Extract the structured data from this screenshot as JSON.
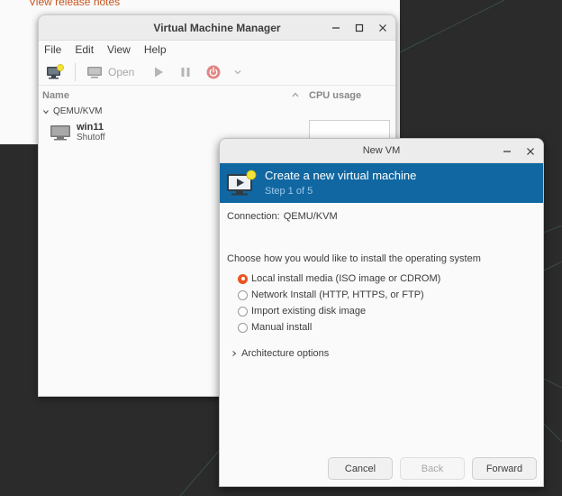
{
  "background": {
    "release_link": "View release notes"
  },
  "vmm": {
    "title": "Virtual Machine Manager",
    "menu": [
      "File",
      "Edit",
      "View",
      "Help"
    ],
    "toolbar": {
      "open_label": "Open"
    },
    "columns": {
      "name": "Name",
      "cpu": "CPU usage"
    },
    "group": "QEMU/KVM",
    "vm": {
      "name": "win11",
      "status": "Shutoff"
    }
  },
  "newvm": {
    "title": "New VM",
    "banner": {
      "title": "Create a new virtual machine",
      "step": "Step 1 of 5"
    },
    "connection": {
      "label": "Connection:",
      "value": "QEMU/KVM"
    },
    "choose_label": "Choose how you would like to install the operating system",
    "options": [
      {
        "label": "Local install media (ISO image or CDROM)",
        "selected": true
      },
      {
        "label": "Network Install (HTTP, HTTPS, or FTP)",
        "selected": false
      },
      {
        "label": "Import existing disk image",
        "selected": false
      },
      {
        "label": "Manual install",
        "selected": false
      }
    ],
    "arch_label": "Architecture options",
    "buttons": {
      "cancel": "Cancel",
      "back": "Back",
      "forward": "Forward"
    }
  },
  "colors": {
    "accent": "#e95420",
    "banner": "#1167a1",
    "desktop": "#2b2b2b"
  },
  "icons": [
    "new-vm-icon",
    "monitor-icon",
    "play-icon",
    "pause-icon",
    "power-icon",
    "chevron-down-icon",
    "minimize-icon",
    "maximize-icon",
    "close-icon"
  ]
}
